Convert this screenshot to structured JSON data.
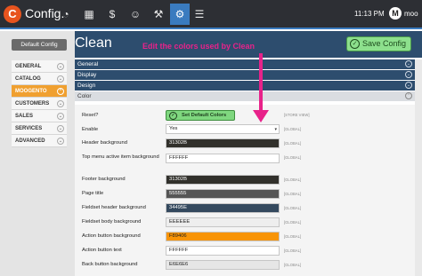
{
  "app": {
    "title": "Config.",
    "logo_letter": "C"
  },
  "toolbar": {
    "icons": [
      "dashboard-icon",
      "products-icon",
      "orders-icon",
      "customers-icon",
      "tools-icon",
      "settings-icon",
      "menu-icon"
    ]
  },
  "status": {
    "time": "11:13 PM",
    "user_initial": "M",
    "user_name": "moo"
  },
  "sidebar": {
    "top_button": "Default Config",
    "items": [
      {
        "label": "GENERAL"
      },
      {
        "label": "CATALOG"
      },
      {
        "label": "MOOGENTO"
      },
      {
        "label": "CUSTOMERS"
      },
      {
        "label": "SALES"
      },
      {
        "label": "SERVICES"
      },
      {
        "label": "ADVANCED"
      }
    ]
  },
  "main": {
    "title": "Clean",
    "save_label": "Save Config",
    "annotation": "Edit the colors used by Clean",
    "sections": [
      {
        "label": "General"
      },
      {
        "label": "Display"
      },
      {
        "label": "Design"
      },
      {
        "label": "Color"
      }
    ]
  },
  "form": {
    "reset_label": "Reset?",
    "default_button": "Set Default Colors",
    "store_view": "[STORE VIEW]",
    "global": "[GLOBAL]",
    "enable_label": "Enable",
    "enable_value": "Yes",
    "fields": [
      {
        "label": "Header background",
        "value": "31302B",
        "bg": "#31302B",
        "fg": "#ffffff"
      },
      {
        "label": "Top menu active item background",
        "value": "FFFFFF",
        "bg": "#FFFFFF",
        "fg": "#222222"
      },
      {
        "label": "Footer background",
        "value": "31302B",
        "bg": "#31302B",
        "fg": "#ffffff"
      },
      {
        "label": "Page title",
        "value": "555555",
        "bg": "#555555",
        "fg": "#ffffff"
      },
      {
        "label": "Fieldset header background",
        "value": "34495E",
        "bg": "#34495E",
        "fg": "#ffffff"
      },
      {
        "label": "Fieldset body background",
        "value": "EEEEEE",
        "bg": "#EEEEEE",
        "fg": "#222222"
      },
      {
        "label": "Action button background",
        "value": "F89406",
        "bg": "#F89406",
        "fg": "#222222"
      },
      {
        "label": "Action button text",
        "value": "FFFFFF",
        "bg": "#FFFFFF",
        "fg": "#222222"
      },
      {
        "label": "Back button background",
        "value": "E6E6E6",
        "bg": "#E6E6E6",
        "fg": "#222222"
      }
    ]
  }
}
